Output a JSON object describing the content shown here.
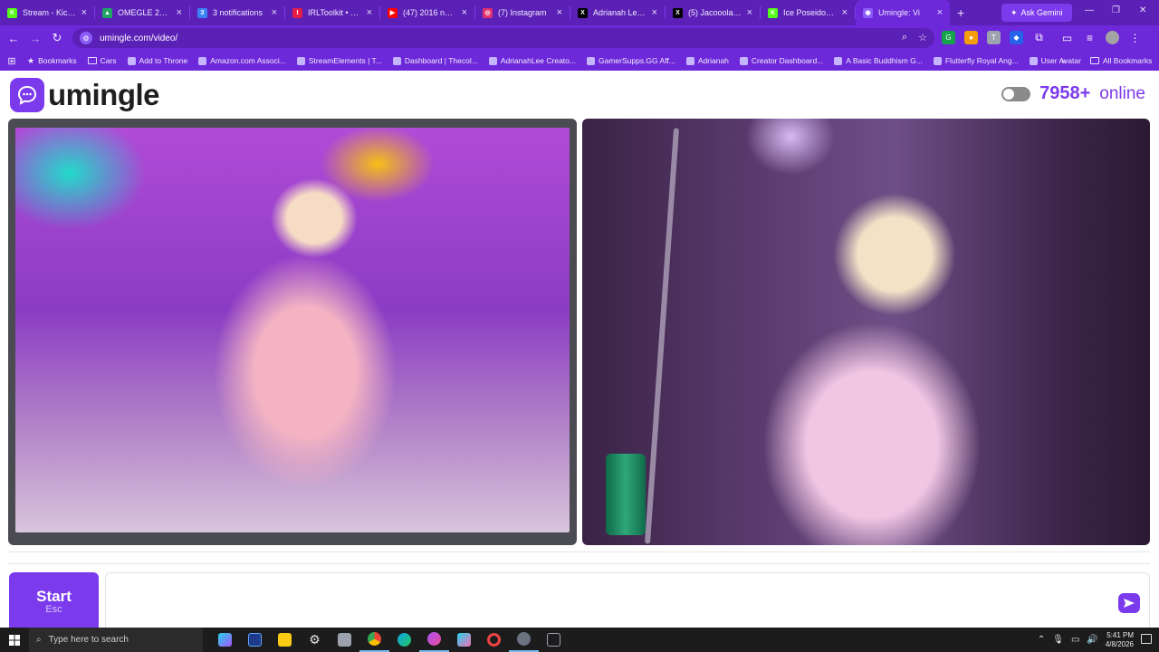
{
  "browser": {
    "tabs": [
      {
        "title": "Stream - Kick D",
        "favicon_color": "#53fc18",
        "favicon_text": "K"
      },
      {
        "title": "OMEGLE 2026",
        "favicon_color": "#1fa463",
        "favicon_text": "▲"
      },
      {
        "title": "3 notifications",
        "favicon_color": "#3b82f6",
        "favicon_text": "3"
      },
      {
        "title": "IRLToolkit • Das",
        "favicon_color": "#e11d48",
        "favicon_text": "I"
      },
      {
        "title": "(47) 2016 nosta",
        "favicon_color": "#ff0000",
        "favicon_text": "▶"
      },
      {
        "title": "(7) Instagram",
        "favicon_color": "#e1306c",
        "favicon_text": "◎"
      },
      {
        "title": "Adrianah Lee (@",
        "favicon_color": "#000000",
        "favicon_text": "X"
      },
      {
        "title": "(5) Jacooola Cli",
        "favicon_color": "#000000",
        "favicon_text": "X"
      },
      {
        "title": "Ice Poseidon St",
        "favicon_color": "#53fc18",
        "favicon_text": "K"
      },
      {
        "title": "Umingle: Vi",
        "favicon_color": "#8b5cf6",
        "favicon_text": "◉",
        "active": true
      }
    ],
    "ask_gemini": "Ask Gemini",
    "url": "umingle.com/video/",
    "bookmarks": [
      {
        "label": "Bookmarks",
        "icon": "star-icon"
      },
      {
        "label": "Cars",
        "icon": "folder-icon"
      },
      {
        "label": "Add to Throne",
        "icon": "throne-icon"
      },
      {
        "label": "Amazon.com Associ...",
        "icon": "amazon-icon"
      },
      {
        "label": "StreamElements | T...",
        "icon": "streamelements-icon"
      },
      {
        "label": "Dashboard | Thecol...",
        "icon": "globe-icon"
      },
      {
        "label": "AdrianahLee Creato...",
        "icon": "mk-icon"
      },
      {
        "label": "GamerSupps.GG Aff...",
        "icon": "gamersupps-icon"
      },
      {
        "label": "Adrianah",
        "icon": "facebook-icon"
      },
      {
        "label": "Creator Dashboard...",
        "icon": "creator-icon"
      },
      {
        "label": "A Basic Buddhism G...",
        "icon": "buddhism-icon"
      },
      {
        "label": "Flutterfly Royal Ang...",
        "icon": "flutterfly-icon"
      },
      {
        "label": "User Avatar",
        "icon": "globe-icon"
      }
    ],
    "all_bookmarks": "All Bookmarks"
  },
  "app": {
    "logo_text": "umingle",
    "online_count": "7958+",
    "online_label": "online",
    "start_label": "Start",
    "start_shortcut": "Esc",
    "accent": "#7c3aed"
  },
  "taskbar": {
    "search_placeholder": "Type here to search",
    "time": "5:41 PM",
    "date": "4/8/2026"
  }
}
